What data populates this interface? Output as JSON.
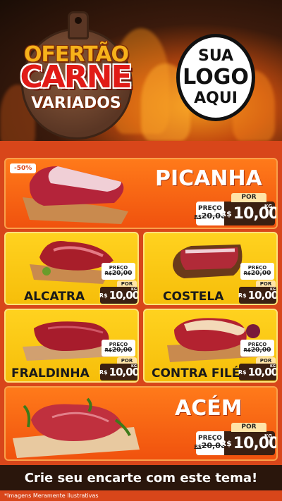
{
  "header": {
    "title_line1": "OFERTÃO",
    "title_line2": "CARNE",
    "title_line3": "VARIADOS",
    "logo_line1": "SUA",
    "logo_line2": "LOGO",
    "logo_line3": "AQUI"
  },
  "products": [
    {
      "name": "PICANHA",
      "badge": "-50%",
      "price_label": "PREÇO",
      "old_price_prefix": "R$",
      "old_price": "20,00",
      "new_label": "POR",
      "currency": "R$",
      "new_price": "10,00",
      "unit": "KG"
    },
    {
      "name": "ALCATRA",
      "price_label": "PREÇO",
      "old_price_prefix": "R$",
      "old_price": "20,00",
      "new_label": "POR",
      "currency": "R$",
      "new_price": "10,00",
      "unit": "KG"
    },
    {
      "name": "COSTELA",
      "price_label": "PREÇO",
      "old_price_prefix": "R$",
      "old_price": "20,00",
      "new_label": "POR",
      "currency": "R$",
      "new_price": "10,00",
      "unit": "KG"
    },
    {
      "name": "FRALDINHA",
      "price_label": "PREÇO",
      "old_price_prefix": "R$",
      "old_price": "20,00",
      "new_label": "POR",
      "currency": "R$",
      "new_price": "10,00",
      "unit": "KG"
    },
    {
      "name": "CONTRA FILÉ",
      "price_label": "PREÇO",
      "old_price_prefix": "R$",
      "old_price": "20,00",
      "new_label": "POR",
      "currency": "R$",
      "new_price": "10,00",
      "unit": "KG"
    },
    {
      "name": "ACÉM",
      "price_label": "PREÇO",
      "old_price_prefix": "R$",
      "old_price": "20,00",
      "new_label": "POR",
      "currency": "R$",
      "new_price": "10,00",
      "unit": "KG"
    }
  ],
  "footer": {
    "cta": "Crie seu encarte com este tema!",
    "disclaimer": "*Imagens Meramente Ilustrativas"
  },
  "colors": {
    "brand_orange": "#f0520e",
    "brand_yellow": "#f6be0a",
    "brand_red": "#e11b17",
    "price_dark": "#3b2012"
  },
  "icons": [
    "meat-image",
    "cutting-board-image",
    "logo-placeholder"
  ]
}
